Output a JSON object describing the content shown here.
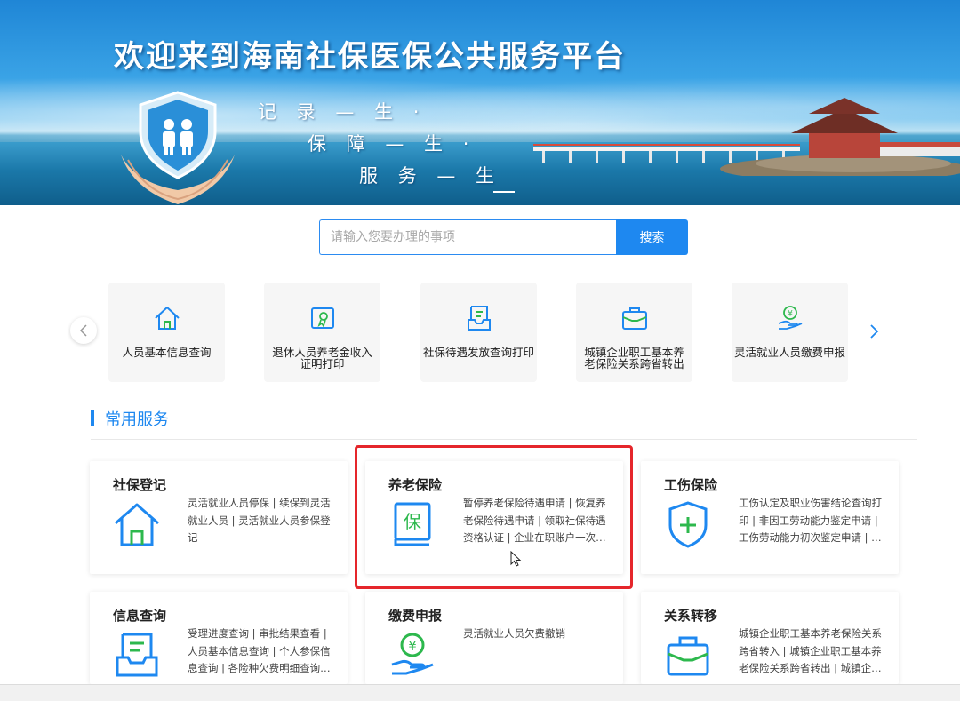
{
  "banner": {
    "title": "欢迎来到海南社保医保公共服务平台",
    "slogan1": "记 录 — 生 ·",
    "slogan2": "保 障 — 生 ·",
    "slogan3": "服 务 — 生"
  },
  "search": {
    "placeholder": "请输入您要办理的事项",
    "button_label": "搜索"
  },
  "quick_links": [
    {
      "label": "人员基本信息查询",
      "icon": "home-icon"
    },
    {
      "label": "退休人员养老金收入证明打印",
      "icon": "certificate-icon"
    },
    {
      "label": "社保待遇发放查询打印",
      "icon": "document-tray-icon"
    },
    {
      "label": "城镇企业职工基本养老保险关系跨省转出",
      "icon": "briefcase-icon"
    },
    {
      "label": "灵活就业人员缴费申报",
      "icon": "coin-hand-icon"
    }
  ],
  "section": {
    "title": "常用服务"
  },
  "services": [
    {
      "title": "社保登记",
      "desc": "灵活就业人员停保 | 续保到灵活就业人员 | 灵活就业人员参保登记",
      "icon": "home-icon"
    },
    {
      "title": "养老保险",
      "desc": "暂停养老保险待遇申请 | 恢复养老保险待遇申请 | 领取社保待遇资格认证 | 企业在职账户一次…",
      "icon": "pension-book-icon"
    },
    {
      "title": "工伤保险",
      "desc": "工伤认定及职业伤害结论查询打印 | 非因工劳动能力鉴定申请 | 工伤劳动能力初次鉴定申请 | …",
      "icon": "shield-plus-icon"
    },
    {
      "title": "信息查询",
      "desc": "受理进度查询 | 审批结果查看 | 人员基本信息查询 | 个人参保信息查询 | 各险种欠费明细查询…",
      "icon": "document-tray-icon"
    },
    {
      "title": "缴费申报",
      "desc": "灵活就业人员欠费撤销",
      "icon": "coin-hand-icon"
    },
    {
      "title": "关系转移",
      "desc": "城镇企业职工基本养老保险关系跨省转入 | 城镇企业职工基本养老保险关系跨省转出 | 城镇企…",
      "icon": "briefcase-icon"
    }
  ],
  "colors": {
    "accent": "#1e88f0",
    "highlight": "#e5262b",
    "icon_green": "#2db84d"
  }
}
